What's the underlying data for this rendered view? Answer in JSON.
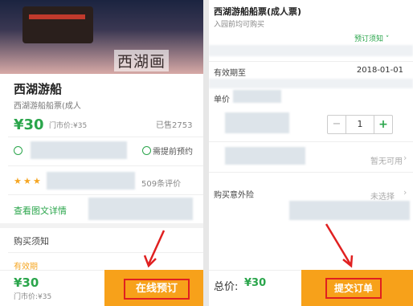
{
  "left": {
    "hero_caption": "西湖画",
    "product_name": "西湖游船",
    "product_sub": "西湖游船船票(成人",
    "price": "¥30",
    "market_price": "门市价:¥35",
    "sold": "已售2753",
    "need_pre_booking": "需提前预约",
    "reviews": "509条评价",
    "detail_link": "查看图文详情",
    "buy_notice": "购买须知",
    "validity_label": "有效期",
    "bottom_price": "¥30",
    "bottom_market": "门市价:¥35",
    "book_button": "在线预订"
  },
  "right": {
    "title": "西湖游船船票(成人票)",
    "subtitle": "入园前均可购买",
    "booking_notice": "预订须知",
    "valid_until_label": "有效期至",
    "valid_until_value": "2018-01-01",
    "unit_price_label": "单价",
    "quantity": "1",
    "unavailable": "暂无可用",
    "insurance_label": "购买意外险",
    "unselected": "未选择",
    "total_label": "总价:",
    "total_value": "¥30",
    "submit_button": "提交订单"
  },
  "colors": {
    "accent_green": "#2aa54b",
    "button_orange": "#f7a11a",
    "highlight_red": "#e02020"
  }
}
